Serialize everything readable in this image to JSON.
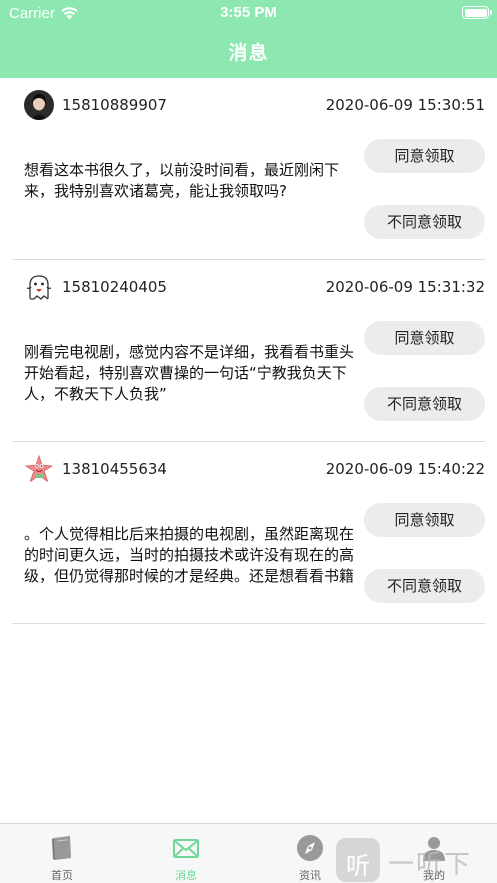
{
  "status_bar": {
    "carrier": "Carrier",
    "time": "3:55 PM"
  },
  "nav": {
    "title": "消息"
  },
  "messages": [
    {
      "phone": "15810889907",
      "timestamp": "2020-06-09 15:30:51",
      "text": "想看这本书很久了，以前没时间看，最近刚闲下来，我特别喜欢诸葛亮，能让我领取吗?",
      "agree_label": "同意领取",
      "refuse_label": "不同意领取",
      "avatar_icon": "photo-avatar-icon"
    },
    {
      "phone": "15810240405",
      "timestamp": "2020-06-09 15:31:32",
      "text": "刚看完电视剧，感觉内容不是详细，我看看书重头开始看起，特别喜欢曹操的一句话“宁教我负天下人，不教天下人负我”",
      "agree_label": "同意领取",
      "refuse_label": "不同意领取",
      "avatar_icon": "cartoon-ghost-avatar-icon"
    },
    {
      "phone": "13810455634",
      "timestamp": "2020-06-09 15:40:22",
      "text": "。个人觉得相比后来拍摄的电视剧，虽然距离现在的时间更久远，当时的拍摄技术或许没有现在的高级，但仍觉得那时候的才是经典。还是想看看书籍",
      "agree_label": "同意领取",
      "refuse_label": "不同意领取",
      "avatar_icon": "starfish-avatar-icon"
    }
  ],
  "tabbar": {
    "items": [
      {
        "label": "首页",
        "icon": "book-icon",
        "active": false
      },
      {
        "label": "消息",
        "icon": "mail-icon",
        "active": true
      },
      {
        "label": "资讯",
        "icon": "compass-icon",
        "active": false
      },
      {
        "label": "我的",
        "icon": "person-icon",
        "active": false
      }
    ]
  },
  "watermark": {
    "text": "一听下载",
    "badge_glyph": "听"
  },
  "colors": {
    "accent": "#8ce7b1",
    "tab_active": "#6ad99a",
    "button_bg": "#ececec"
  }
}
